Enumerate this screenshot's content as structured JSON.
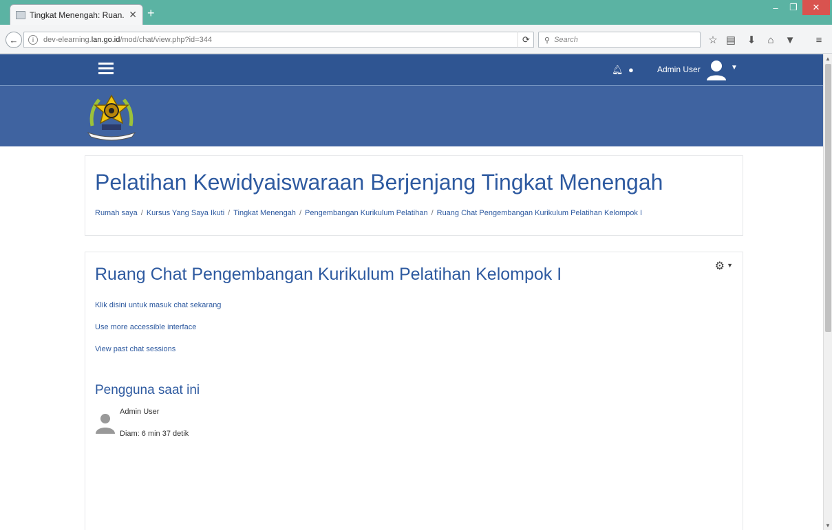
{
  "browser": {
    "tab_title": "Tingkat Menengah: Ruan...",
    "tab_close": "✕",
    "new_tab": "+",
    "url_prefix": "dev-elearning.",
    "url_host": "lan.go.id",
    "url_path": "/mod/chat/view.php?id=344",
    "search_placeholder": "Search",
    "controls": {
      "minimize": "–",
      "maximize": "❐",
      "close": "✕"
    }
  },
  "navbar": {
    "user_name": "Admin User"
  },
  "header": {
    "title": "Pelatihan Kewidyaiswaraan Berjenjang Tingkat Menengah",
    "breadcrumb": [
      "Rumah saya",
      "Kursus Yang Saya Ikuti",
      "Tingkat Menengah",
      "Pengembangan Kurikulum Pelatihan",
      "Ruang Chat Pengembangan Kurikulum Pelatihan Kelompok I"
    ],
    "separator": "/"
  },
  "main": {
    "title": "Ruang Chat Pengembangan Kurikulum Pelatihan Kelompok I",
    "links": {
      "enter_chat": "Klik disini untuk masuk chat sekarang",
      "accessible": "Use more accessible interface",
      "past_sessions": "View past chat sessions"
    },
    "current_users": {
      "heading": "Pengguna saat ini",
      "name": "Admin User",
      "idle": "Diam: 6 min 37 detik"
    }
  },
  "colors": {
    "navbar": "#2f5592",
    "banner": "#3f63a0",
    "link": "#2e5aa0",
    "tabbar": "#5bb3a3"
  }
}
